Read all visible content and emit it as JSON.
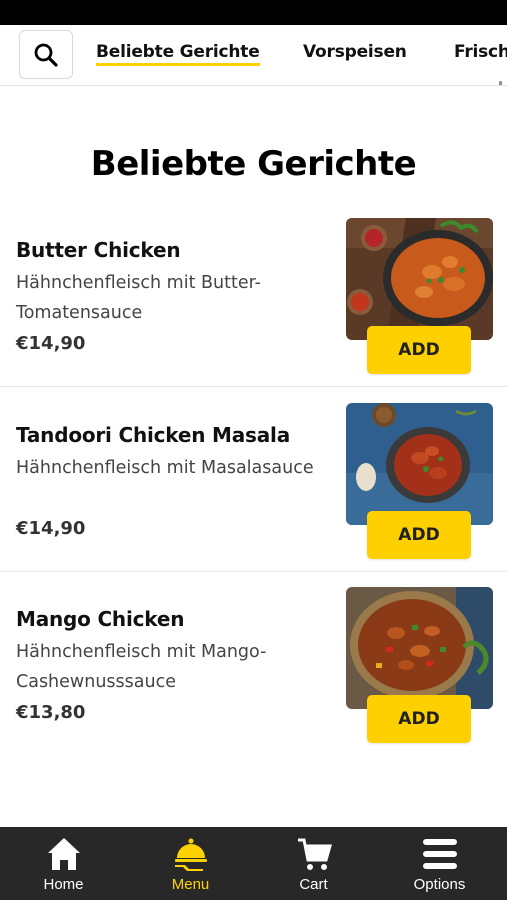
{
  "colors": {
    "accent": "#ffd200",
    "add_button": "#ffd000",
    "nav_bg": "#282828",
    "status_bar": "#000000"
  },
  "category_nav": {
    "search_icon": "search-icon",
    "tabs": [
      {
        "label": "Beliebte Gerichte",
        "active": true
      },
      {
        "label": "Vorspeisen",
        "active": false
      },
      {
        "label": "Frisch",
        "active": false
      }
    ]
  },
  "section": {
    "title": "Beliebte Gerichte"
  },
  "items": [
    {
      "name": "Butter Chicken",
      "description": "Hähnchenfleisch mit Butter-Tomatensauce",
      "price": "€14,90",
      "add_label": "ADD",
      "image": "butter-chicken-photo"
    },
    {
      "name": "Tandoori Chicken Masala",
      "description": "Hähnchenfleisch mit Masalasauce",
      "price": "€14,90",
      "add_label": "ADD",
      "image": "tandoori-chicken-masala-photo"
    },
    {
      "name": "Mango Chicken",
      "description": "Hähnchenfleisch mit Mango-Cashewnusssauce",
      "price": "€13,80",
      "add_label": "ADD",
      "image": "mango-chicken-photo"
    }
  ],
  "bottom_nav": [
    {
      "label": "Home",
      "icon": "home-icon",
      "active": false
    },
    {
      "label": "Menu",
      "icon": "cloche-icon",
      "active": true
    },
    {
      "label": "Cart",
      "icon": "cart-icon",
      "active": false
    },
    {
      "label": "Options",
      "icon": "hamburger-icon",
      "active": false
    }
  ]
}
